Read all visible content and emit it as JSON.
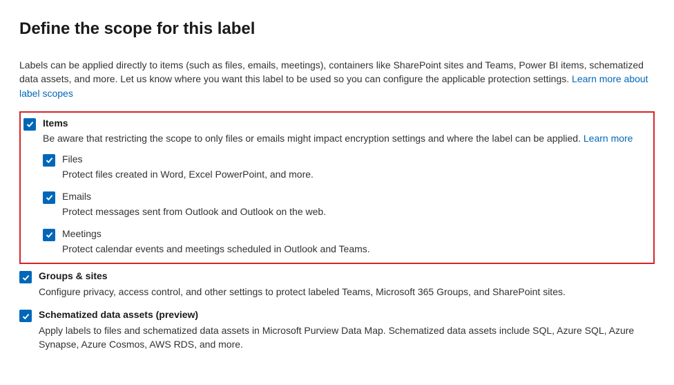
{
  "title": "Define the scope for this label",
  "intro_text": "Labels can be applied directly to items (such as files, emails, meetings), containers like SharePoint sites and Teams, Power BI items, schematized data assets, and more. Let us know where you want this label to be used so you can configure the applicable protection settings. ",
  "intro_link": "Learn more about label scopes",
  "items": {
    "label": "Items",
    "desc": "Be aware that restricting the scope to only files or emails might impact encryption settings and where the label can be applied. ",
    "desc_link": "Learn more",
    "sub": {
      "files": {
        "label": "Files",
        "desc": "Protect files created in Word, Excel PowerPoint, and more."
      },
      "emails": {
        "label": "Emails",
        "desc": "Protect messages sent from Outlook and Outlook on the web."
      },
      "meetings": {
        "label": "Meetings",
        "desc": "Protect calendar events and meetings scheduled in Outlook and Teams."
      }
    }
  },
  "groups": {
    "label": "Groups & sites",
    "desc": "Configure privacy, access control, and other settings to protect labeled Teams, Microsoft 365 Groups, and SharePoint sites."
  },
  "schematized": {
    "label": "Schematized data assets (preview)",
    "desc": "Apply labels to files and schematized data assets in Microsoft Purview Data Map. Schematized data assets include SQL, Azure SQL, Azure Synapse, Azure Cosmos, AWS RDS, and more."
  }
}
